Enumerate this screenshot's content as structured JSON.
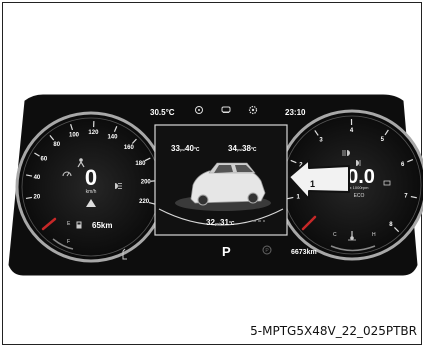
{
  "top_bar": {
    "outside_temp": "30.5°C",
    "clock": "23:10"
  },
  "speedometer": {
    "ticks": [
      "20",
      "40",
      "60",
      "80",
      "100",
      "120",
      "140",
      "160",
      "180",
      "200",
      "220"
    ],
    "speed": "0",
    "unit": "km/h",
    "range": "65km"
  },
  "tachometer": {
    "ticks": [
      "1",
      "2",
      "3",
      "4",
      "5",
      "6",
      "7",
      "8"
    ],
    "rpm": "0.0",
    "unit": "x 1000rpm",
    "mode": "ECO",
    "fuel_marks": [
      "E",
      "F"
    ],
    "temp_marks": [
      "C",
      "H"
    ]
  },
  "tires": {
    "front_left": "33",
    "front_left_temp": "40",
    "front_right": "34",
    "front_right_temp": "38",
    "rear": "32",
    "rear_temp": "31",
    "pressure_unit": "psi",
    "temp_unit": "°C"
  },
  "status": {
    "gear": "P",
    "odometer": "6673km"
  },
  "callout": {
    "number": "1"
  },
  "figure_code": "5-MPTG5X48V_22_025PTBR",
  "colors": {
    "panel": "#0d0d0d",
    "dial_ring": "#bdbdbd",
    "dial_fill": "#1a1a1a",
    "text": "#ffffff",
    "accent_red": "#c62828",
    "arrow_fill": "#f2f2f2"
  }
}
